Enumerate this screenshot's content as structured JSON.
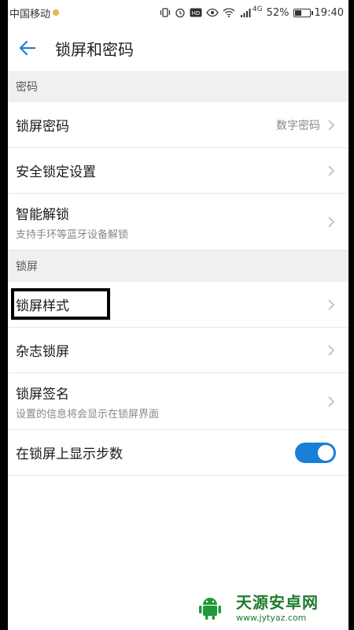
{
  "status_bar": {
    "carrier": "中国移动",
    "battery": "52%",
    "time": "19:40",
    "network": "4G",
    "battery_level": 0.52
  },
  "header": {
    "title": "锁屏和密码"
  },
  "sections": [
    {
      "title": "密码",
      "items": [
        {
          "title": "锁屏密码",
          "value": "数字密码"
        },
        {
          "title": "安全锁定设置"
        },
        {
          "title": "智能解锁",
          "subtitle": "支持手环等蓝牙设备解锁"
        }
      ]
    },
    {
      "title": "锁屏",
      "items": [
        {
          "title": "锁屏样式"
        },
        {
          "title": "杂志锁屏"
        },
        {
          "title": "锁屏签名",
          "subtitle": "设置的信息将会显示在锁屏界面"
        },
        {
          "title": "在锁屏上显示步数",
          "toggle_on": true
        }
      ]
    }
  ],
  "watermark": {
    "brand": "天源安卓网",
    "url": "www.jytyaz.com"
  },
  "colors": {
    "accent": "#1a7fd6",
    "section_bg": "#f0f0f0",
    "watermark_green": "#1f7a2e"
  }
}
